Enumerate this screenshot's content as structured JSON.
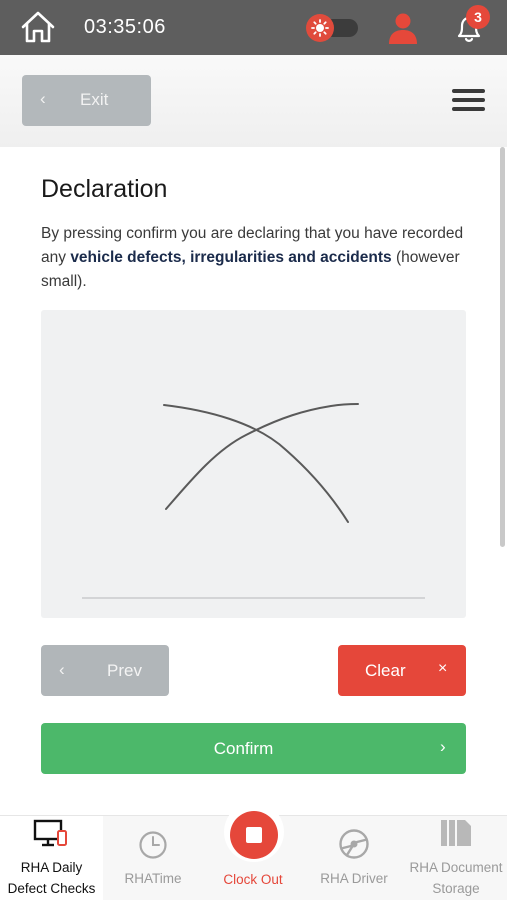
{
  "status_bar": {
    "time": "03:35:06",
    "notification_count": "3",
    "icons": [
      "home-icon",
      "sun-icon",
      "user-icon",
      "bell-icon"
    ],
    "accent_color": "#e5483a"
  },
  "header": {
    "exit_label": "Exit",
    "exit_icon": "chevron-left-icon",
    "menu_icon": "hamburger-menu-icon"
  },
  "declaration": {
    "title": "Declaration",
    "text_before": "By pressing confirm you are declaring that you have recorded any ",
    "text_bold": "vehicle defects, irregularities and accidents",
    "text_after": " (however small)."
  },
  "actions": {
    "prev_label": "Prev",
    "clear_label": "Clear",
    "clear_icon": "close-icon",
    "confirm_label": "Confirm",
    "confirm_icon": "chevron-right-icon",
    "colors": {
      "clear": "#e5473a",
      "confirm": "#4cb86a",
      "disabled": "#b1b6b9"
    }
  },
  "bottom_nav": {
    "items": [
      {
        "line1": "RHA Daily",
        "line2": "Defect Checks",
        "icon": "monitor-phone-icon",
        "active": true
      },
      {
        "line1": "RHATime",
        "icon": "clock-icon",
        "active": false
      },
      {
        "line1": "Clock Out",
        "icon": "stop-icon",
        "active": false
      },
      {
        "line1": "RHA Driver",
        "icon": "steering-wheel-icon",
        "active": false
      },
      {
        "line1": "RHA Document",
        "line2": "Storage",
        "icon": "documents-icon",
        "active": false
      }
    ]
  }
}
